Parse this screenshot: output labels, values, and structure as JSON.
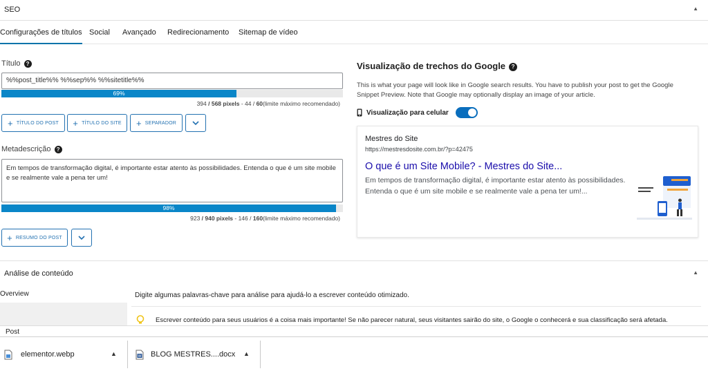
{
  "header": {
    "title": "SEO"
  },
  "tabs": [
    {
      "label": "Configurações de títulos"
    },
    {
      "label": "Social"
    },
    {
      "label": "Avançado"
    },
    {
      "label": "Redirecionamento"
    },
    {
      "label": "Sitemap de vídeo"
    }
  ],
  "title_field": {
    "label": "Título",
    "value": "%%post_title%% %%sep%% %%sitetitle%%",
    "progress_percent": 69,
    "progress_label": "69%",
    "counter_used": "394",
    "counter_slash": " / ",
    "counter_max": "568 pixels",
    "counter_sep": " - 44 / ",
    "counter_chars": "60",
    "counter_note": "(limite máximo recomendado)"
  },
  "title_buttons": [
    {
      "label": "Título do post"
    },
    {
      "label": "Título do site"
    },
    {
      "label": "Separador"
    }
  ],
  "meta_field": {
    "label": "Metadescrição",
    "value": "Em tempos de transformação digital, é importante estar atento às possibilidades. Entenda o que é um site mobile e se realmente vale a pena ter um!",
    "progress_percent": 98,
    "progress_label": "98%",
    "counter_used": "923",
    "counter_slash": " / ",
    "counter_max": "940 pixels",
    "counter_sep": " - 146 / ",
    "counter_chars": "160",
    "counter_note": "(limite máximo recomendado)"
  },
  "meta_buttons": [
    {
      "label": "Resumo do post"
    }
  ],
  "preview": {
    "heading": "Visualização de trechos do Google",
    "description": "This is what your page will look like in Google search results. You have to publish your post to get the Google Snippet Preview. Note that Google may optionally display an image of your article.",
    "mobile_label": "Visualização para celular",
    "mobile_enabled": true,
    "site_name": "Mestres do Site",
    "url": "https://mestresdosite.com.br/?p=42475",
    "result_title": "O que é um Site Mobile? - Mestres do Site...",
    "result_description": "Em tempos de transformação digital, é importante estar atento às possibilidades. Entenda o que é um site mobile e se realmente vale a pena ter um!...",
    "thumb_text": "orem ipsum\nor sit amet"
  },
  "analysis": {
    "title": "Análise de conteúdo",
    "overview_tab": "Overview",
    "hint": "Digite algumas palavras-chave para análise para ajudá-lo a escrever conteúdo otimizado.",
    "item": "Escrever conteúdo para seus usuários é a coisa mais importante! Se não parecer natural, seus visitantes sairão do site, o Google o conhecerá e sua classificação será afetada."
  },
  "post_bar": {
    "label": "Post"
  },
  "downloads": [
    {
      "name": "elementor.webp",
      "icon": "image-file-icon"
    },
    {
      "name": "BLOG MESTRES....docx",
      "icon": "word-doc-icon"
    }
  ],
  "colors": {
    "accent": "#2271b1",
    "progress": "#0a86c8",
    "link": "#1a0dab"
  }
}
